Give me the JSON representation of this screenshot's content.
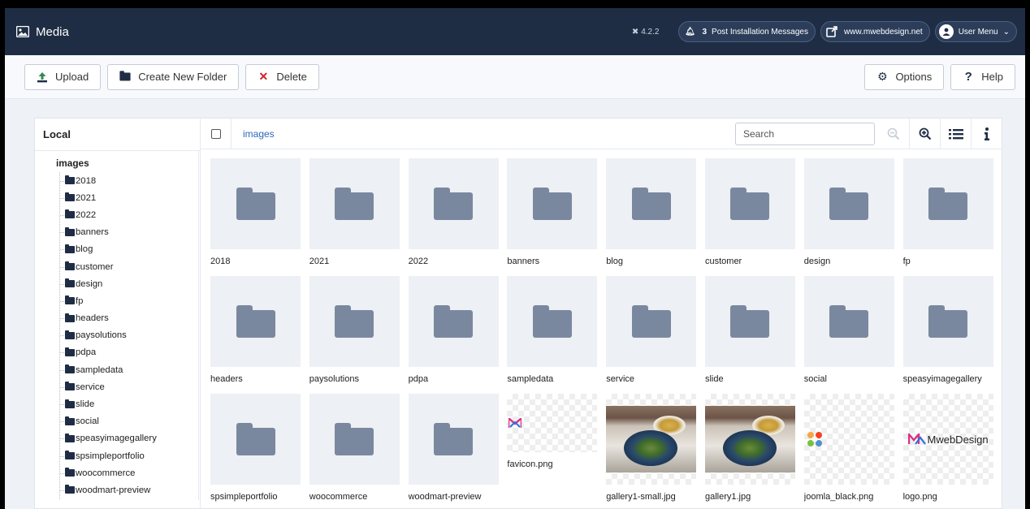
{
  "header": {
    "title": "Media",
    "version": "4.2.2",
    "notifications": {
      "count": "3",
      "label": "Post Installation Messages"
    },
    "site_link": "www.mwebdesign.net",
    "user_menu": "User Menu"
  },
  "toolbar": {
    "upload": "Upload",
    "new_folder": "Create New Folder",
    "delete": "Delete",
    "options": "Options",
    "help": "Help"
  },
  "sidebar": {
    "heading": "Local",
    "root": "images",
    "folders": [
      "2018",
      "2021",
      "2022",
      "banners",
      "blog",
      "customer",
      "design",
      "fp",
      "headers",
      "paysolutions",
      "pdpa",
      "sampledata",
      "service",
      "slide",
      "social",
      "speasyimagegallery",
      "spsimpleportfolio",
      "woocommerce",
      "woodmart-preview"
    ]
  },
  "browser": {
    "breadcrumb": "images",
    "search_placeholder": "Search",
    "items": [
      {
        "name": "2018",
        "type": "folder"
      },
      {
        "name": "2021",
        "type": "folder"
      },
      {
        "name": "2022",
        "type": "folder"
      },
      {
        "name": "banners",
        "type": "folder"
      },
      {
        "name": "blog",
        "type": "folder"
      },
      {
        "name": "customer",
        "type": "folder"
      },
      {
        "name": "design",
        "type": "folder"
      },
      {
        "name": "fp",
        "type": "folder"
      },
      {
        "name": "headers",
        "type": "folder"
      },
      {
        "name": "paysolutions",
        "type": "folder"
      },
      {
        "name": "pdpa",
        "type": "folder"
      },
      {
        "name": "sampledata",
        "type": "folder"
      },
      {
        "name": "service",
        "type": "folder"
      },
      {
        "name": "slide",
        "type": "folder"
      },
      {
        "name": "social",
        "type": "folder"
      },
      {
        "name": "speasyimagegallery",
        "type": "folder"
      },
      {
        "name": "spsimpleportfolio",
        "type": "folder"
      },
      {
        "name": "woocommerce",
        "type": "folder"
      },
      {
        "name": "woodmart-preview",
        "type": "folder"
      },
      {
        "name": "favicon.png",
        "type": "favicon"
      },
      {
        "name": "gallery1-small.jpg",
        "type": "photo"
      },
      {
        "name": "gallery1.jpg",
        "type": "photo"
      },
      {
        "name": "joomla_black.png",
        "type": "joomla"
      },
      {
        "name": "logo.png",
        "type": "logo",
        "logo_text": "MwebDesign"
      }
    ]
  },
  "colors": {
    "header_bg": "#1f2d44",
    "folder": "#7a889f",
    "link": "#2a69b8",
    "delete": "#d0222a"
  }
}
